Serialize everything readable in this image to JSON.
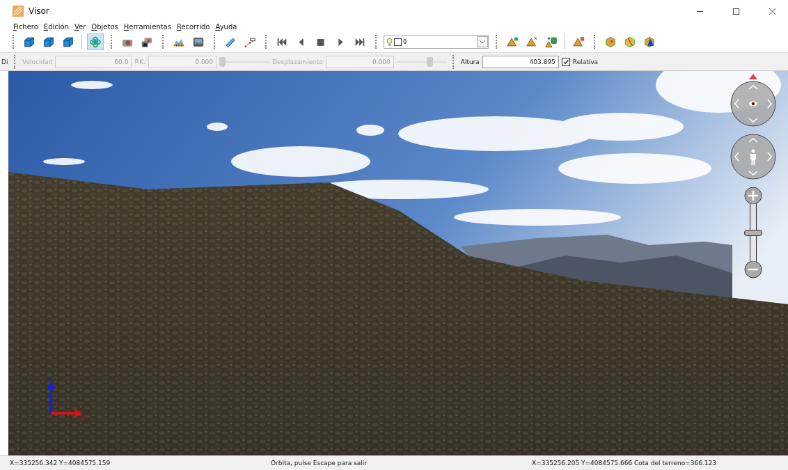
{
  "window": {
    "title": "Visor"
  },
  "behind_label": "Di",
  "menu": [
    {
      "label": "Fichero"
    },
    {
      "label": "Edición"
    },
    {
      "label": "Ver"
    },
    {
      "label": "Objetos"
    },
    {
      "label": "Herramientas"
    },
    {
      "label": "Recorrido"
    },
    {
      "label": "Ayuda"
    }
  ],
  "toolbar": [
    {
      "items": [
        {
          "kind": "cube",
          "selected": false
        },
        {
          "kind": "cube",
          "selected": false
        },
        {
          "kind": "cube",
          "selected": false
        },
        {
          "kind": "divider"
        },
        {
          "kind": "orbit",
          "selected": true
        }
      ]
    },
    {
      "items": [
        {
          "kind": "camera",
          "selected": false
        },
        {
          "kind": "cameras",
          "selected": false
        }
      ]
    },
    {
      "items": [
        {
          "kind": "surface",
          "selected": false
        },
        {
          "kind": "picture",
          "selected": false
        }
      ]
    },
    {
      "items": [
        {
          "kind": "ruler",
          "selected": false
        },
        {
          "kind": "path",
          "selected": false
        }
      ]
    },
    {
      "items": [
        {
          "kind": "first",
          "selected": false
        },
        {
          "kind": "prev",
          "selected": false
        },
        {
          "kind": "stop",
          "selected": false
        },
        {
          "kind": "play",
          "selected": false
        },
        {
          "kind": "last",
          "selected": false
        }
      ]
    },
    {
      "items": [
        {
          "kind": "combo",
          "value": "0"
        }
      ]
    },
    {
      "items": [
        {
          "kind": "pyramid-add",
          "selected": false
        },
        {
          "kind": "pyramid-move",
          "selected": false
        },
        {
          "kind": "pyramid-cube",
          "selected": false
        },
        {
          "kind": "divider"
        },
        {
          "kind": "pyramid-delete",
          "selected": false
        }
      ]
    },
    {
      "items": [
        {
          "kind": "hex-dot",
          "selected": false
        },
        {
          "kind": "hex-line",
          "selected": false
        },
        {
          "kind": "hex-tri",
          "selected": false
        }
      ]
    }
  ],
  "params": {
    "speed": {
      "label": "Velocidad",
      "value": "60.0",
      "disabled": true
    },
    "pk": {
      "label": "P.K.",
      "value": "0.000",
      "disabled": true,
      "level": 0.0
    },
    "offset": {
      "label": "Desplazamiento",
      "value": "0.000",
      "disabled": true,
      "level": 0.7
    },
    "height": {
      "label": "Altura",
      "value": "403.895"
    },
    "relative": {
      "label": "Relativa",
      "checked": true
    }
  },
  "axes": {
    "z": "Z",
    "x": "X"
  },
  "zoom": {
    "level": 0.5
  },
  "status_bar": {
    "left": "X=335256.342 Y=4084575.159",
    "center": "Órbita, pulse Escape para salir",
    "right": "X=335256.205 Y=4084575.666 Cota del terreno=366.123"
  }
}
